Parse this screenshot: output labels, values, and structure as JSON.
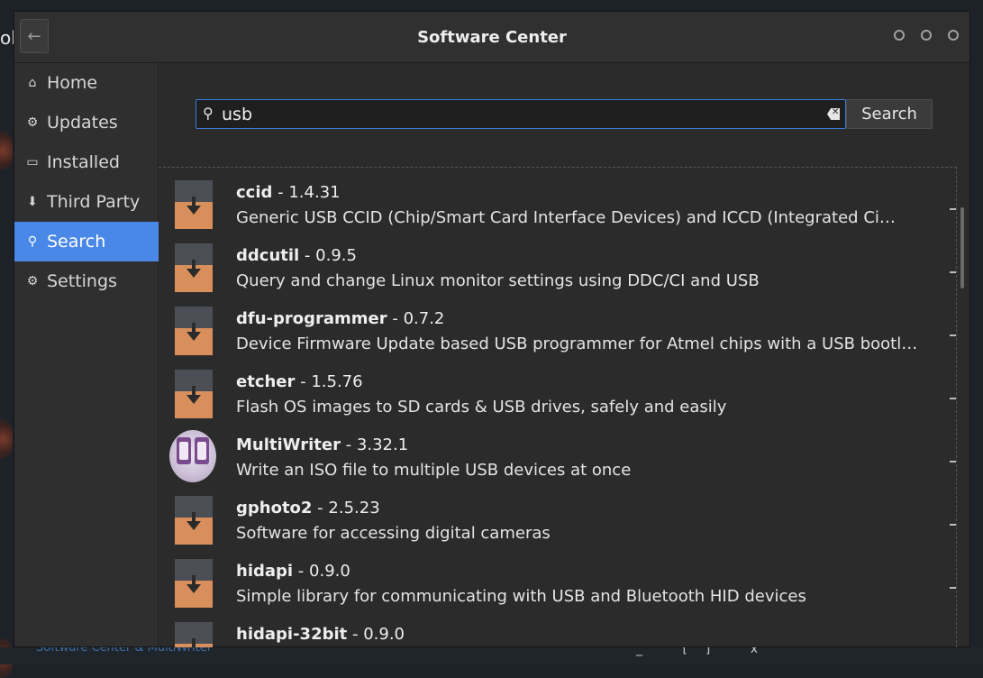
{
  "desktop": {
    "fragment_text": "ol",
    "taskbar_label": "Software Center & MultiWriter",
    "taskbar_controls": "_ [] x"
  },
  "window": {
    "title": "Software Center",
    "back_glyph": "←"
  },
  "sidebar": {
    "items": [
      {
        "label": "Home",
        "icon": "home-icon",
        "glyph": "⌂",
        "active": false
      },
      {
        "label": "Updates",
        "icon": "gear-icon",
        "glyph": "⚙",
        "active": false
      },
      {
        "label": "Installed",
        "icon": "monitor-icon",
        "glyph": "▭",
        "active": false
      },
      {
        "label": "Third Party",
        "icon": "download-arrow-icon",
        "glyph": "⬇",
        "active": false
      },
      {
        "label": "Search",
        "icon": "search-icon",
        "glyph": "⚲",
        "active": true
      },
      {
        "label": "Settings",
        "icon": "settings-icon",
        "glyph": "⚙",
        "active": false
      }
    ]
  },
  "search": {
    "query": "usb",
    "button_label": "Search"
  },
  "results": [
    {
      "name": "ccid",
      "version": " - 1.4.31",
      "description": "Generic USB CCID (Chip/Smart Card Interface Devices) and ICCD (Integrated Ci…",
      "icon": "package-icon"
    },
    {
      "name": "ddcutil",
      "version": " - 0.9.5",
      "description": "Query and change Linux monitor settings using DDC/CI and USB",
      "icon": "package-icon"
    },
    {
      "name": "dfu-programmer",
      "version": " - 0.7.2",
      "description": "Device Firmware Update based USB programmer for Atmel chips with a USB bootl…",
      "icon": "package-icon"
    },
    {
      "name": "etcher",
      "version": " - 1.5.76",
      "description": "Flash OS images to SD cards & USB drives, safely and easily",
      "icon": "package-icon"
    },
    {
      "name": "MultiWriter",
      "version": " - 3.32.1",
      "description": "Write an ISO file to multiple USB devices at once",
      "icon": "multiwriter-icon"
    },
    {
      "name": "gphoto2",
      "version": " - 2.5.23",
      "description": "Software for accessing digital cameras",
      "icon": "package-icon"
    },
    {
      "name": "hidapi",
      "version": " - 0.9.0",
      "description": "Simple library for communicating with USB and Bluetooth HID devices",
      "icon": "package-icon"
    },
    {
      "name": "hidapi-32bit",
      "version": " - 0.9.0",
      "description": "",
      "icon": "package-icon"
    }
  ],
  "colors": {
    "accent": "#4a88e8",
    "package_icon_top": "#4b4e55",
    "package_icon_bottom": "#d98f5b"
  }
}
